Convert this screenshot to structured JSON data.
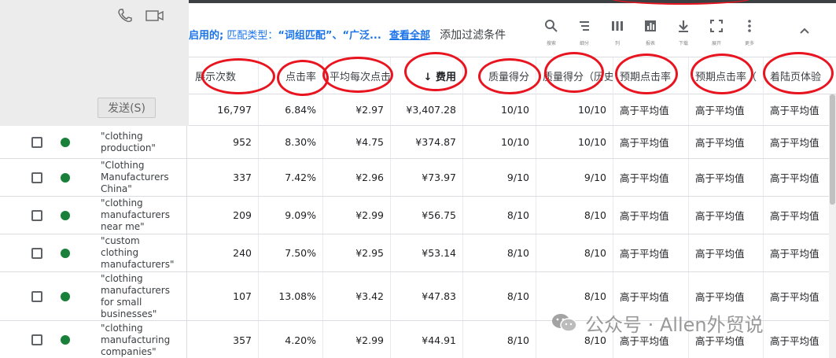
{
  "chat": {
    "send_label": "发送(S)"
  },
  "filter": {
    "enabled_text": "启用的;",
    "match_prefix": "匹配类型：",
    "match_values": "“词组匹配”、“广泛...",
    "view_all": "查看全部",
    "add_filter": "添加过滤条件"
  },
  "toolbar": {
    "items": [
      {
        "icon": "search-icon",
        "label": "搜索"
      },
      {
        "icon": "filter-icon",
        "label": "细分"
      },
      {
        "icon": "columns-icon",
        "label": "列"
      },
      {
        "icon": "chart-icon",
        "label": "报表"
      },
      {
        "icon": "download-icon",
        "label": "下载"
      },
      {
        "icon": "expand-icon",
        "label": "展开"
      },
      {
        "icon": "more-icon",
        "label": "更多"
      }
    ]
  },
  "table": {
    "headers": [
      "展示次数",
      "点击率",
      "平均每次点击",
      "↓ 费用",
      "质量得分",
      "质量得分（历史）",
      "预期点击率",
      "预期点击率（",
      "着陆页体验"
    ],
    "totals": [
      "16,797",
      "6.84%",
      "¥2.97",
      "¥3,407.28",
      "10/10",
      "10/10",
      "高于平均值",
      "高于平均值",
      "高于平均值"
    ],
    "rows": [
      {
        "keyword": "\"clothing\nproduction\"",
        "values": [
          "952",
          "8.30%",
          "¥4.75",
          "¥374.87",
          "10/10",
          "10/10",
          "高于平均值",
          "高于平均值",
          "高于平均值"
        ]
      },
      {
        "keyword": "\"Clothing\nManufacturers\nChina\"",
        "values": [
          "337",
          "7.42%",
          "¥2.96",
          "¥73.97",
          "9/10",
          "9/10",
          "高于平均值",
          "高于平均值",
          "高于平均值"
        ]
      },
      {
        "keyword": "\"clothing\nmanufacturers\nnear me\"",
        "values": [
          "209",
          "9.09%",
          "¥2.99",
          "¥56.75",
          "8/10",
          "8/10",
          "高于平均值",
          "高于平均值",
          "高于平均值"
        ]
      },
      {
        "keyword": "\"custom\nclothing\nmanufacturers\"",
        "values": [
          "240",
          "7.50%",
          "¥2.95",
          "¥53.14",
          "8/10",
          "8/10",
          "高于平均值",
          "高于平均值",
          "高于平均值"
        ]
      },
      {
        "keyword": "\"clothing\nmanufacturers\nfor small\nbusinesses\"",
        "values": [
          "107",
          "13.08%",
          "¥3.42",
          "¥47.83",
          "8/10",
          "8/10",
          "高于平均值",
          "高于平均值",
          "高于平均值"
        ]
      },
      {
        "keyword": "\"clothing\nmanufacturing\ncompanies\"",
        "values": [
          "357",
          "4.20%",
          "¥2.99",
          "¥44.91",
          "8/10",
          "8/10",
          "高于平均值",
          "高于平均值",
          "高于平均值"
        ]
      }
    ]
  },
  "watermark": {
    "text": "公众号 · Allen外贸说"
  },
  "colors": {
    "accent_blue": "#1a73e8",
    "status_green": "#188038",
    "annotation_red": "#e8141f"
  }
}
